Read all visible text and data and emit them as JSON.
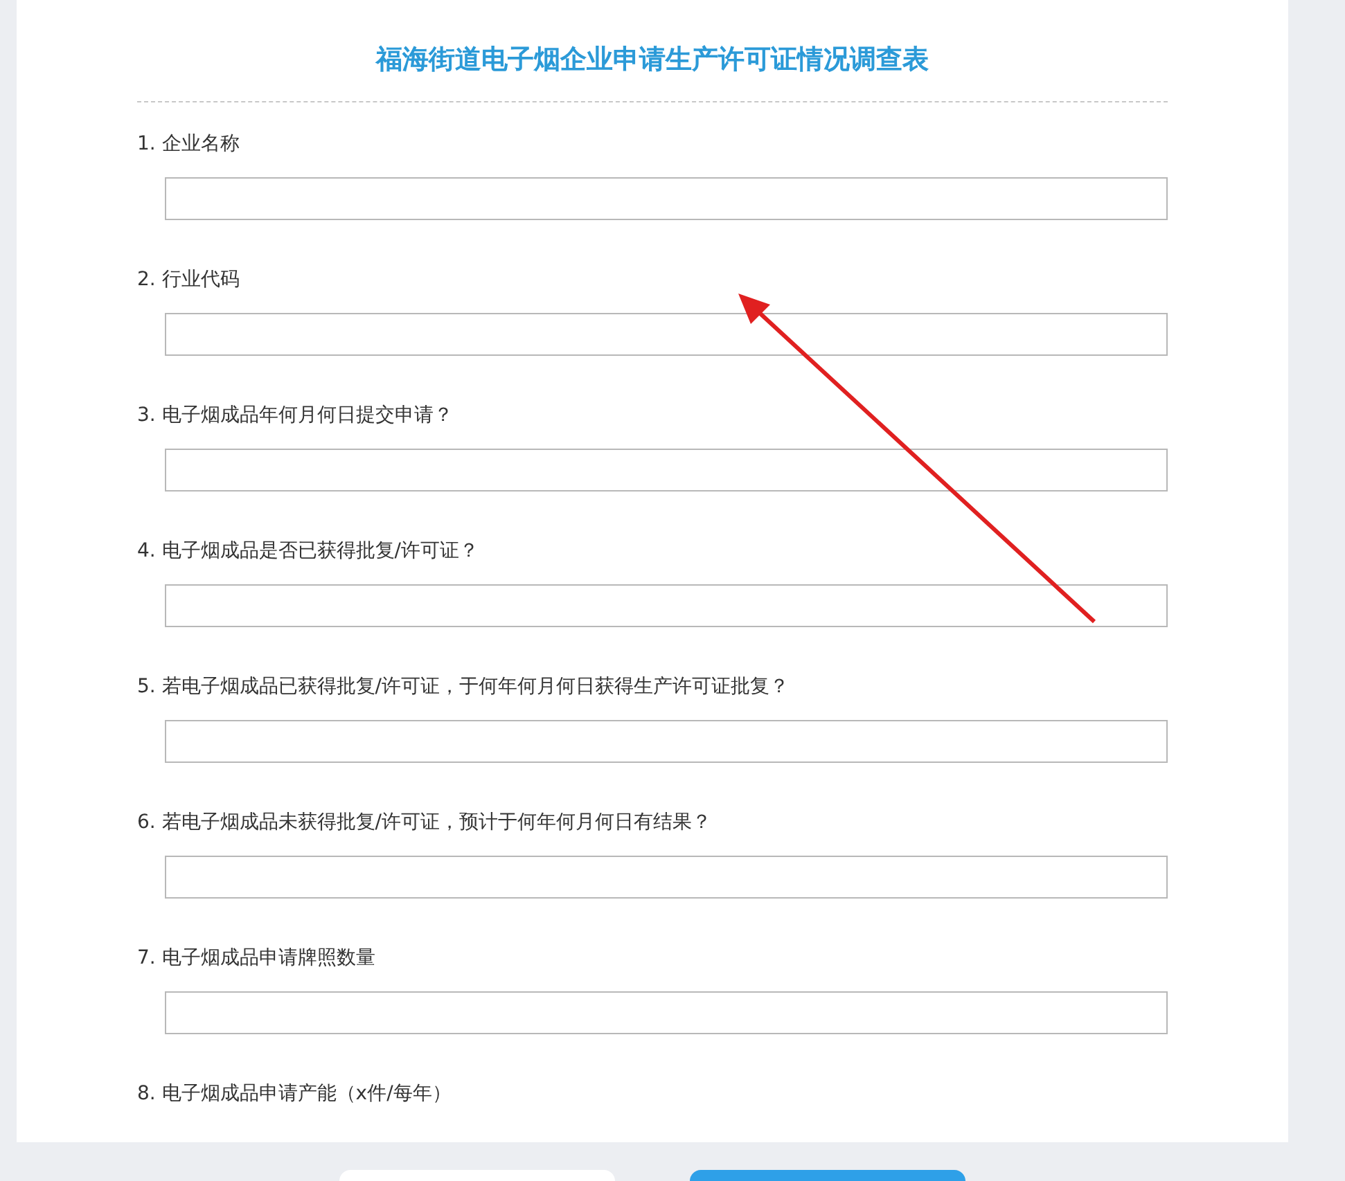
{
  "title": "福海街道电子烟企业申请生产许可证情况调查表",
  "questions": [
    {
      "label": "1. 企业名称",
      "kind": "text"
    },
    {
      "label": "2. 行业代码",
      "kind": "text"
    },
    {
      "label": "3. 电子烟成品年何月何日提交申请？",
      "kind": "text"
    },
    {
      "label": "4. 电子烟成品是否已获得批复/许可证？",
      "kind": "text"
    },
    {
      "label": "5. 若电子烟成品已获得批复/许可证，于何年何月何日获得生产许可证批复？",
      "kind": "text"
    },
    {
      "label": "6. 若电子烟成品未获得批复/许可证，预计于何年何月何日有结果？",
      "kind": "text"
    },
    {
      "label": "7. 电子烟成品申请牌照数量",
      "kind": "text"
    },
    {
      "label": "8. 电子烟成品申请产能（x件/每年）",
      "kind": "label_only"
    }
  ],
  "buttons": [
    {
      "kind": "secondary"
    },
    {
      "kind": "primary"
    }
  ],
  "annotation": {
    "kind": "arrow"
  }
}
